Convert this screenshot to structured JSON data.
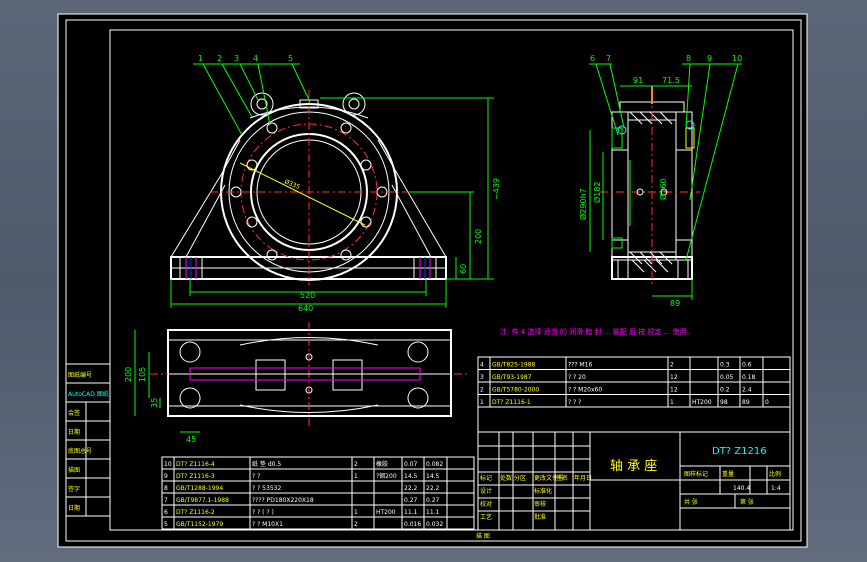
{
  "balloons": [
    "1",
    "2",
    "3",
    "4",
    "5",
    "6",
    "7",
    "8",
    "9",
    "10"
  ],
  "dimensions": {
    "front_diameter": "Ø335",
    "front_height_total": "~439",
    "front_center_height": "200",
    "front_base_height": "60",
    "front_span_bolts": "520",
    "front_total_width": "640",
    "side_top_left": "91",
    "side_top_right": "71.5",
    "side_dia_outer": "Ø290h7",
    "side_dia_inner": "Ø182",
    "side_dia_bore": "Ø160",
    "side_bottom": "89",
    "plan_height": "200",
    "plan_inner": "105",
    "plan_small": "35",
    "plan_bottom": "45"
  },
  "note": "注: 件 4 选择 适当 的 润滑 脂 封 ... 装配 后 按 规定 ... 使用。",
  "side_stamps": [
    "图纸编号",
    "AutoCAD 图纸",
    "会签",
    "日期",
    "底图总号",
    "描图",
    "签字",
    "日期"
  ],
  "parts_upper": [
    [
      "4",
      "GB/T825-1988",
      "??? M16",
      "2",
      "",
      "0.3",
      "0.6"
    ],
    [
      "3",
      "GB/T93-1987",
      "? ? 20",
      "12",
      "",
      "0.05",
      "0.18"
    ],
    [
      "2",
      "GB/T5780-2000",
      "? ? M20x60",
      "12",
      "",
      "0.2",
      "2.4"
    ],
    [
      "1",
      "DT? Z1116-1",
      "? ? ?",
      "1",
      "HT200",
      "98",
      "89",
      "0"
    ]
  ],
  "parts_lower": [
    [
      "10",
      "DT? Z1116-4",
      "纸 垫 d0.5",
      "2",
      "橡胶",
      "0.07",
      "0.082"
    ],
    [
      "9",
      "DT? Z1116-3",
      "? ?",
      "1",
      "?钢200",
      "14.5",
      "14.5"
    ],
    [
      "8",
      "GB/T1288-1994",
      "? ? 53532",
      "",
      "",
      "22.2",
      "22.2"
    ],
    [
      "7",
      "GB/T9877.1-1988",
      "???? PD180X220X18",
      "",
      "",
      "0.27",
      "0.27"
    ],
    [
      "6",
      "DT? Z1116-2",
      "? ? ( ? )",
      "1",
      "HT200",
      "11.1",
      "11.1"
    ],
    [
      "5",
      "GB/T1152-1979",
      "? ? M10X1",
      "2",
      "",
      "0.016",
      "0.032"
    ]
  ],
  "title_block": {
    "drawing_no": "DT? Z1216",
    "name_cn": "轴 承 座",
    "mass": "140.4",
    "scale": "1:4",
    "h_mark": "图样标记",
    "h_mass": "重量",
    "h_scale": "比例",
    "sheet_total": "共 张",
    "sheet_no": "第 张",
    "roles": [
      "标记",
      "处数",
      "分区",
      "更改文件号",
      "签名",
      "年月日",
      "设计",
      "标准化",
      "校对",
      "工艺",
      "审核",
      "批准"
    ],
    "footer": "描 图"
  }
}
